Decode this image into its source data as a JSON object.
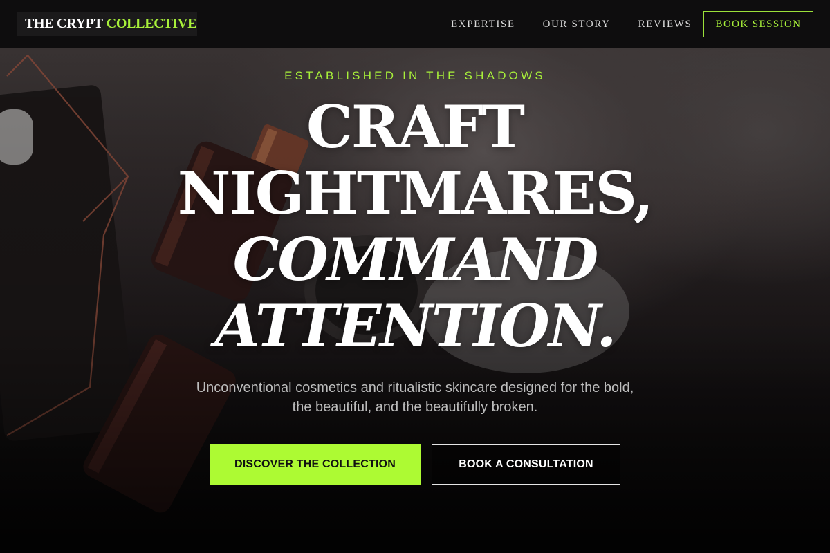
{
  "brand": {
    "name_part1": "THE CRYPT",
    "name_part2": "COLLECTIVE",
    "accent_color": "#a8f03a"
  },
  "nav": {
    "links": [
      {
        "label": "EXPERTISE"
      },
      {
        "label": "OUR STORY"
      },
      {
        "label": "REVIEWS"
      }
    ],
    "cta_label": "BOOK SESSION"
  },
  "hero": {
    "eyebrow": "ESTABLISHED IN THE SHADOWS",
    "headline": {
      "line1": "CRAFT",
      "line2": "NIGHTMARES,",
      "line3": "COMMAND",
      "line4": "ATTENTION."
    },
    "subtext": "Unconventional cosmetics and ritualistic skincare designed for the bold, the beautiful, and the beautifully broken.",
    "primary_button": "DISCOVER THE COLLECTION",
    "secondary_button": "BOOK A CONSULTATION"
  }
}
